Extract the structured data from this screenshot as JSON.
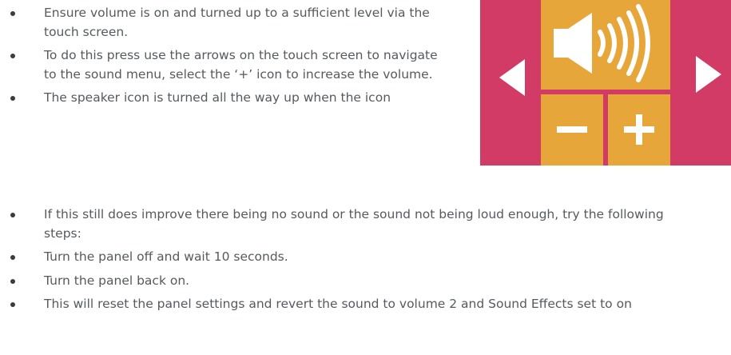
{
  "instructions_top": [
    "Ensure volume is on and turned up to a sufficient level via the touch screen.",
    "To do this press use the arrows on the touch screen to navigate to the sound menu, select the ‘+’ icon to increase the volume.",
    "The speaker icon is turned all the way up when the icon"
  ],
  "instructions_bottom": [
    "If this still does improve there being no sound or the sound not being loud enough, try the following steps:",
    "Turn the panel off and wait 10 seconds.",
    "Turn the panel back on.",
    "This will reset the panel settings and revert the sound to volume 2 and Sound Effects set to on"
  ],
  "panel_image": {
    "icons": [
      "left-arrow-icon",
      "speaker-volume-icon",
      "right-arrow-icon",
      "minus-icon",
      "plus-icon"
    ],
    "colors": {
      "background": "#d23b66",
      "tile": "#e7a63a",
      "icon": "#ffffff"
    }
  }
}
